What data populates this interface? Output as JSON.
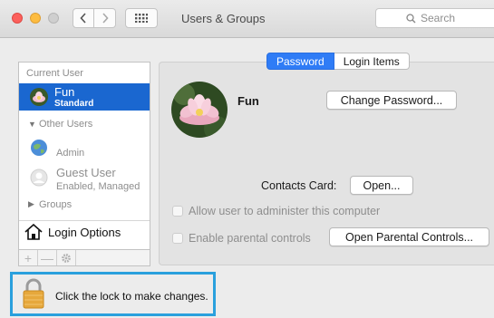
{
  "window": {
    "title": "Users & Groups",
    "search_placeholder": "Search"
  },
  "sidebar": {
    "current_user_header": "Current User",
    "current_user": {
      "name": "Fun",
      "role": "Standard"
    },
    "other_users_header": "Other Users",
    "other_users": [
      {
        "name": "Admin",
        "detail": ""
      },
      {
        "name": "Guest User",
        "detail": "Enabled, Managed"
      }
    ],
    "groups_label": "Groups",
    "login_options_label": "Login Options",
    "toolbar": {
      "add": "+",
      "remove": "—"
    }
  },
  "tabs": [
    {
      "label": "Password",
      "active": true
    },
    {
      "label": "Login Items",
      "active": false
    }
  ],
  "main": {
    "user_name": "Fun",
    "change_password_label": "Change Password...",
    "contacts_card_label": "Contacts Card:",
    "open_label": "Open...",
    "allow_admin_label": "Allow user to administer this computer",
    "parental_controls_label": "Enable parental controls",
    "open_parental_controls_label": "Open Parental Controls..."
  },
  "lock": {
    "message": "Click the lock to make changes."
  },
  "colors": {
    "selection": "#1a67d0",
    "tab_active": "#2f7cf6",
    "highlight_border": "#2aa0dd"
  }
}
